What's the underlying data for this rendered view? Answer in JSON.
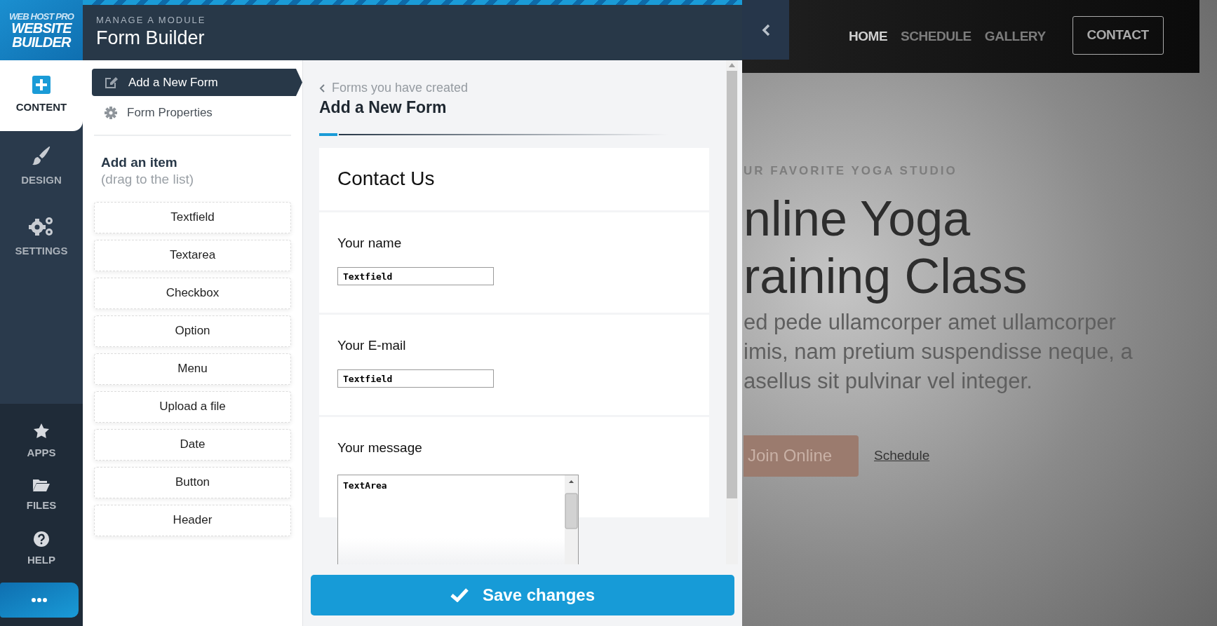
{
  "logo": {
    "lines": [
      "WEB HOST PRO",
      "WEBSITE",
      "BUILDER"
    ]
  },
  "header": {
    "eyebrow": "MANAGE A MODULE",
    "title": "Form Builder"
  },
  "nav": [
    {
      "label": "CONTENT",
      "selected": true
    },
    {
      "label": "DESIGN",
      "selected": false
    },
    {
      "label": "SETTINGS",
      "selected": false
    }
  ],
  "nav_bottom": [
    {
      "label": "APPS"
    },
    {
      "label": "FILES"
    },
    {
      "label": "HELP"
    }
  ],
  "module_menu": [
    {
      "label": "Add a New Form",
      "selected": true
    },
    {
      "label": "Form Properties",
      "selected": false
    }
  ],
  "add_item": {
    "title": "Add an item",
    "hint": "(drag to the list)",
    "items": [
      "Textfield",
      "Textarea",
      "Checkbox",
      "Option",
      "Menu",
      "Upload a file",
      "Date",
      "Button",
      "Header"
    ]
  },
  "editor": {
    "breadcrumb": "Forms you have created",
    "title": "Add a New Form",
    "form": {
      "title": "Contact Us",
      "fields": [
        {
          "kind": "textfield",
          "label": "Your name",
          "value": "Textfield"
        },
        {
          "kind": "textfield",
          "label": "Your E-mail",
          "value": "Textfield"
        },
        {
          "kind": "textarea",
          "label": "Your message",
          "value": "TextArea"
        }
      ]
    }
  },
  "save_button": "Save changes",
  "preview": {
    "nav": [
      {
        "label": "HOME",
        "selected": true
      },
      {
        "label": "SCHEDULE",
        "selected": false
      },
      {
        "label": "GALLERY",
        "selected": false
      }
    ],
    "cta": "CONTACT",
    "eyebrow": "UR FAVORITE YOGA STUDIO",
    "headline": [
      "nline Yoga",
      "raining Class"
    ],
    "body": [
      "ed pede ullamcorper amet ullamcorper",
      "imis, nam pretium suspendisse neque, a",
      "asellus sit pulvinar vel integer."
    ],
    "primary_button": "Join Online",
    "link": "Schedule"
  }
}
